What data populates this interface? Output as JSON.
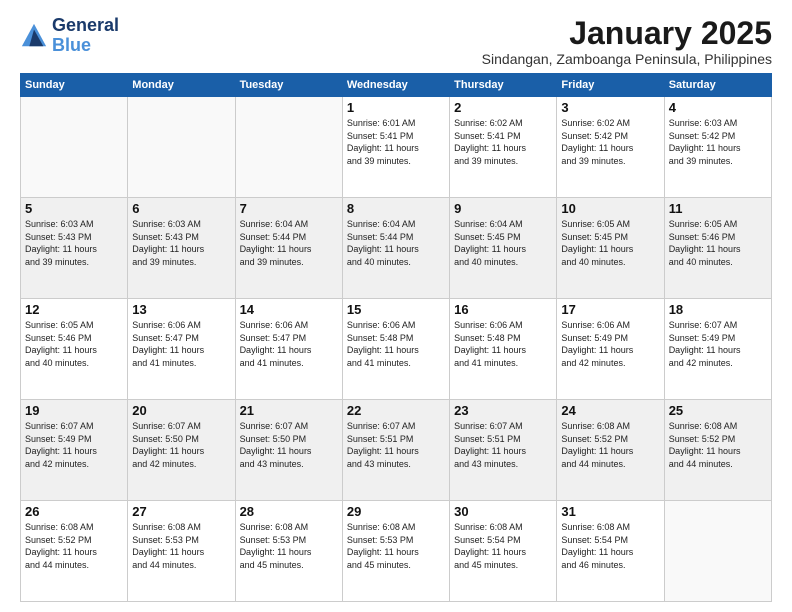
{
  "header": {
    "logo_line1": "General",
    "logo_line2": "Blue",
    "month": "January 2025",
    "location": "Sindangan, Zamboanga Peninsula, Philippines"
  },
  "weekdays": [
    "Sunday",
    "Monday",
    "Tuesday",
    "Wednesday",
    "Thursday",
    "Friday",
    "Saturday"
  ],
  "weeks": [
    [
      {
        "day": "",
        "info": ""
      },
      {
        "day": "",
        "info": ""
      },
      {
        "day": "",
        "info": ""
      },
      {
        "day": "1",
        "info": "Sunrise: 6:01 AM\nSunset: 5:41 PM\nDaylight: 11 hours\nand 39 minutes."
      },
      {
        "day": "2",
        "info": "Sunrise: 6:02 AM\nSunset: 5:41 PM\nDaylight: 11 hours\nand 39 minutes."
      },
      {
        "day": "3",
        "info": "Sunrise: 6:02 AM\nSunset: 5:42 PM\nDaylight: 11 hours\nand 39 minutes."
      },
      {
        "day": "4",
        "info": "Sunrise: 6:03 AM\nSunset: 5:42 PM\nDaylight: 11 hours\nand 39 minutes."
      }
    ],
    [
      {
        "day": "5",
        "info": "Sunrise: 6:03 AM\nSunset: 5:43 PM\nDaylight: 11 hours\nand 39 minutes."
      },
      {
        "day": "6",
        "info": "Sunrise: 6:03 AM\nSunset: 5:43 PM\nDaylight: 11 hours\nand 39 minutes."
      },
      {
        "day": "7",
        "info": "Sunrise: 6:04 AM\nSunset: 5:44 PM\nDaylight: 11 hours\nand 39 minutes."
      },
      {
        "day": "8",
        "info": "Sunrise: 6:04 AM\nSunset: 5:44 PM\nDaylight: 11 hours\nand 40 minutes."
      },
      {
        "day": "9",
        "info": "Sunrise: 6:04 AM\nSunset: 5:45 PM\nDaylight: 11 hours\nand 40 minutes."
      },
      {
        "day": "10",
        "info": "Sunrise: 6:05 AM\nSunset: 5:45 PM\nDaylight: 11 hours\nand 40 minutes."
      },
      {
        "day": "11",
        "info": "Sunrise: 6:05 AM\nSunset: 5:46 PM\nDaylight: 11 hours\nand 40 minutes."
      }
    ],
    [
      {
        "day": "12",
        "info": "Sunrise: 6:05 AM\nSunset: 5:46 PM\nDaylight: 11 hours\nand 40 minutes."
      },
      {
        "day": "13",
        "info": "Sunrise: 6:06 AM\nSunset: 5:47 PM\nDaylight: 11 hours\nand 41 minutes."
      },
      {
        "day": "14",
        "info": "Sunrise: 6:06 AM\nSunset: 5:47 PM\nDaylight: 11 hours\nand 41 minutes."
      },
      {
        "day": "15",
        "info": "Sunrise: 6:06 AM\nSunset: 5:48 PM\nDaylight: 11 hours\nand 41 minutes."
      },
      {
        "day": "16",
        "info": "Sunrise: 6:06 AM\nSunset: 5:48 PM\nDaylight: 11 hours\nand 41 minutes."
      },
      {
        "day": "17",
        "info": "Sunrise: 6:06 AM\nSunset: 5:49 PM\nDaylight: 11 hours\nand 42 minutes."
      },
      {
        "day": "18",
        "info": "Sunrise: 6:07 AM\nSunset: 5:49 PM\nDaylight: 11 hours\nand 42 minutes."
      }
    ],
    [
      {
        "day": "19",
        "info": "Sunrise: 6:07 AM\nSunset: 5:49 PM\nDaylight: 11 hours\nand 42 minutes."
      },
      {
        "day": "20",
        "info": "Sunrise: 6:07 AM\nSunset: 5:50 PM\nDaylight: 11 hours\nand 42 minutes."
      },
      {
        "day": "21",
        "info": "Sunrise: 6:07 AM\nSunset: 5:50 PM\nDaylight: 11 hours\nand 43 minutes."
      },
      {
        "day": "22",
        "info": "Sunrise: 6:07 AM\nSunset: 5:51 PM\nDaylight: 11 hours\nand 43 minutes."
      },
      {
        "day": "23",
        "info": "Sunrise: 6:07 AM\nSunset: 5:51 PM\nDaylight: 11 hours\nand 43 minutes."
      },
      {
        "day": "24",
        "info": "Sunrise: 6:08 AM\nSunset: 5:52 PM\nDaylight: 11 hours\nand 44 minutes."
      },
      {
        "day": "25",
        "info": "Sunrise: 6:08 AM\nSunset: 5:52 PM\nDaylight: 11 hours\nand 44 minutes."
      }
    ],
    [
      {
        "day": "26",
        "info": "Sunrise: 6:08 AM\nSunset: 5:52 PM\nDaylight: 11 hours\nand 44 minutes."
      },
      {
        "day": "27",
        "info": "Sunrise: 6:08 AM\nSunset: 5:53 PM\nDaylight: 11 hours\nand 44 minutes."
      },
      {
        "day": "28",
        "info": "Sunrise: 6:08 AM\nSunset: 5:53 PM\nDaylight: 11 hours\nand 45 minutes."
      },
      {
        "day": "29",
        "info": "Sunrise: 6:08 AM\nSunset: 5:53 PM\nDaylight: 11 hours\nand 45 minutes."
      },
      {
        "day": "30",
        "info": "Sunrise: 6:08 AM\nSunset: 5:54 PM\nDaylight: 11 hours\nand 45 minutes."
      },
      {
        "day": "31",
        "info": "Sunrise: 6:08 AM\nSunset: 5:54 PM\nDaylight: 11 hours\nand 46 minutes."
      },
      {
        "day": "",
        "info": ""
      }
    ]
  ]
}
